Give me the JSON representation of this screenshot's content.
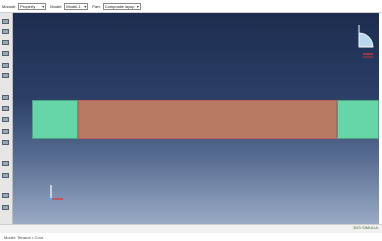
{
  "context_bar": {
    "module_label": "Module:",
    "module_value": "Property",
    "model_label": "Model:",
    "model_value": "Model-1",
    "part_label": "Part:",
    "part_value": "Composite layup"
  },
  "status": {
    "text": "Model: Tension   •   Coor"
  },
  "brand": {
    "text": "3DS SIMULIA"
  },
  "colors": {
    "viewport_top": "#1c2d4f",
    "viewport_bottom": "#9aabc6",
    "section_green": "#66d6a8",
    "section_brown": "#b87a63",
    "edge_red": "#c45a5a"
  },
  "icons": [
    "module-combo-arrow-icon",
    "model-combo-arrow-icon",
    "part-combo-arrow-icon",
    "triad-icon",
    "view-triad-icon"
  ]
}
